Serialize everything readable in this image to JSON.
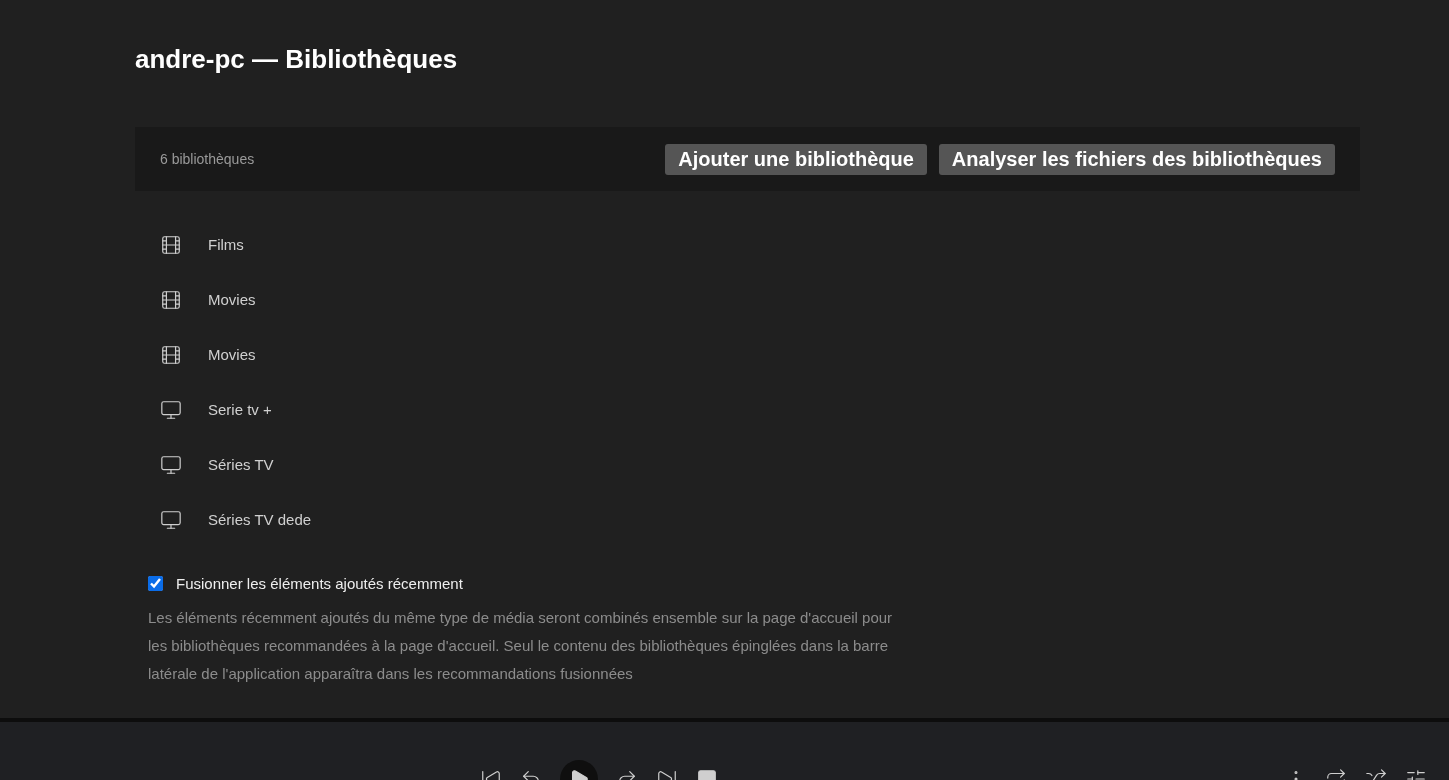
{
  "page_title": "andre-pc — Bibliothèques",
  "toolbar": {
    "count": "6 bibliothèques",
    "buttons": [
      "Ajouter une bibliothèque",
      "Analyser les fichiers des bibliothèques"
    ]
  },
  "libraries": [
    {
      "kind": "movie",
      "name": "Films"
    },
    {
      "kind": "movie",
      "name": "Movies"
    },
    {
      "kind": "movie",
      "name": "Movies"
    },
    {
      "kind": "tv",
      "name": "Serie tv +"
    },
    {
      "kind": "tv",
      "name": "Séries TV"
    },
    {
      "kind": "tv",
      "name": "Séries TV dede"
    }
  ],
  "merge_option": {
    "label": "Fusionner les éléments ajoutés récemment",
    "checked": true,
    "description": "Les éléments récemment ajoutés du même type de média seront combinés ensemble sur la page d'accueil pour les bibliothèques recommandées à la page d'accueil. Seul le contenu des bibliothèques épinglées dans la barre latérale de l'application apparaîtra dans les recommandations fusionnées"
  }
}
